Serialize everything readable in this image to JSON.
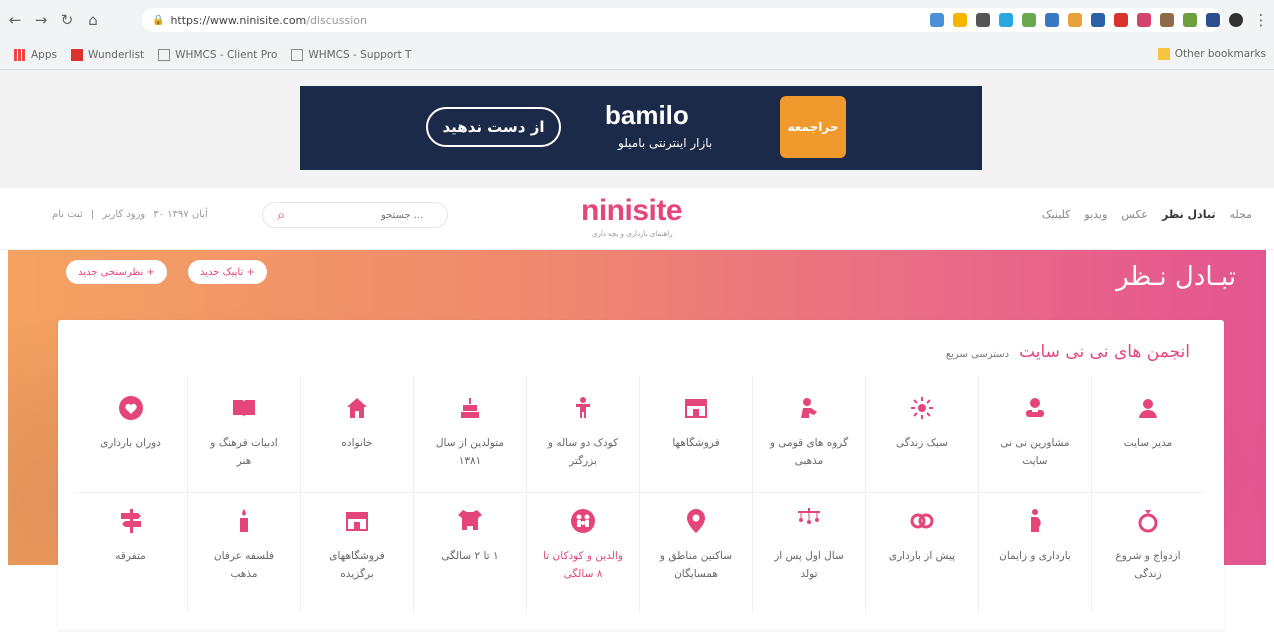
{
  "browser": {
    "url_host": "https://www.ninisite.com",
    "url_path": "/discussion",
    "bookmarks": [
      "Apps",
      "Wunderlist",
      "WHMCS - Client Pro",
      "WHMCS - Support T"
    ],
    "other_bookmarks": "Other bookmarks"
  },
  "ad": {
    "button": "از دست ندهید",
    "brand": "bamilo",
    "tagline": "بازار اینترنتی بامیلو",
    "badge": "حراجمعه"
  },
  "header": {
    "logo": "ninisite",
    "logo_sub": "راهنمای بارداری و بچه داری",
    "nav": [
      "مجله",
      "تبادل نظر",
      "عکس",
      "ویدیو",
      "کلینیک"
    ],
    "search_placeholder": "جستجو ...",
    "date": "۳۰ آبان ۱۳۹۷",
    "login": "ورود کاربر",
    "separator": "|",
    "register": "ثبت نام"
  },
  "hero": {
    "title": "تبـادل نـظر",
    "new_topic": "تاپیک جدید +",
    "new_poll": "نظرسنجی جدید +"
  },
  "forums": {
    "title": "انجمن های نی نی سایت",
    "subtitle": "دسترسی سریع",
    "items": [
      {
        "label": "مدیر سایت",
        "icon": "admin-icon"
      },
      {
        "label": "مشاورین نی نی سایت",
        "icon": "consultants-icon"
      },
      {
        "label": "سبک زندگی",
        "icon": "sun-icon"
      },
      {
        "label": "گروه های قومی و مذهبی",
        "icon": "ethnic-icon"
      },
      {
        "label": "فروشگاهها",
        "icon": "shop-icon"
      },
      {
        "label": "کودک دو ساله و بزرگتر",
        "icon": "child-icon"
      },
      {
        "label": "متولدین از سال ۱۳۸۱",
        "icon": "birthday-cake-icon"
      },
      {
        "label": "خانواده",
        "icon": "home-icon"
      },
      {
        "label": "ادبیات فرهنگ و هنر",
        "icon": "book-icon"
      },
      {
        "label": "دوران بارداری",
        "icon": "heart-icon"
      },
      {
        "label": "ازدواج و شروع زندگی",
        "icon": "ring-icon"
      },
      {
        "label": "بارداری و زایمان",
        "icon": "pregnant-icon"
      },
      {
        "label": "پیش از بارداری",
        "icon": "rings-icon"
      },
      {
        "label": "سال اول پس از تولد",
        "icon": "mobile-icon"
      },
      {
        "label": "ساکنین مناطق و همسایگان",
        "icon": "location-pin-icon"
      },
      {
        "label": "والدین و کودکان تا ۸ سالگی",
        "icon": "family-icon"
      },
      {
        "label": "۱ تا ۲ سالگی",
        "icon": "onesie-icon"
      },
      {
        "label": "فروشگاههای برگزیده",
        "icon": "featured-shop-icon"
      },
      {
        "label": "فلسفه عرفان مذهب",
        "icon": "candle-icon"
      },
      {
        "label": "متفرقه",
        "icon": "signpost-icon"
      }
    ]
  },
  "colors": {
    "accent": "#e5467a",
    "chrome": "#f1f3f4"
  }
}
